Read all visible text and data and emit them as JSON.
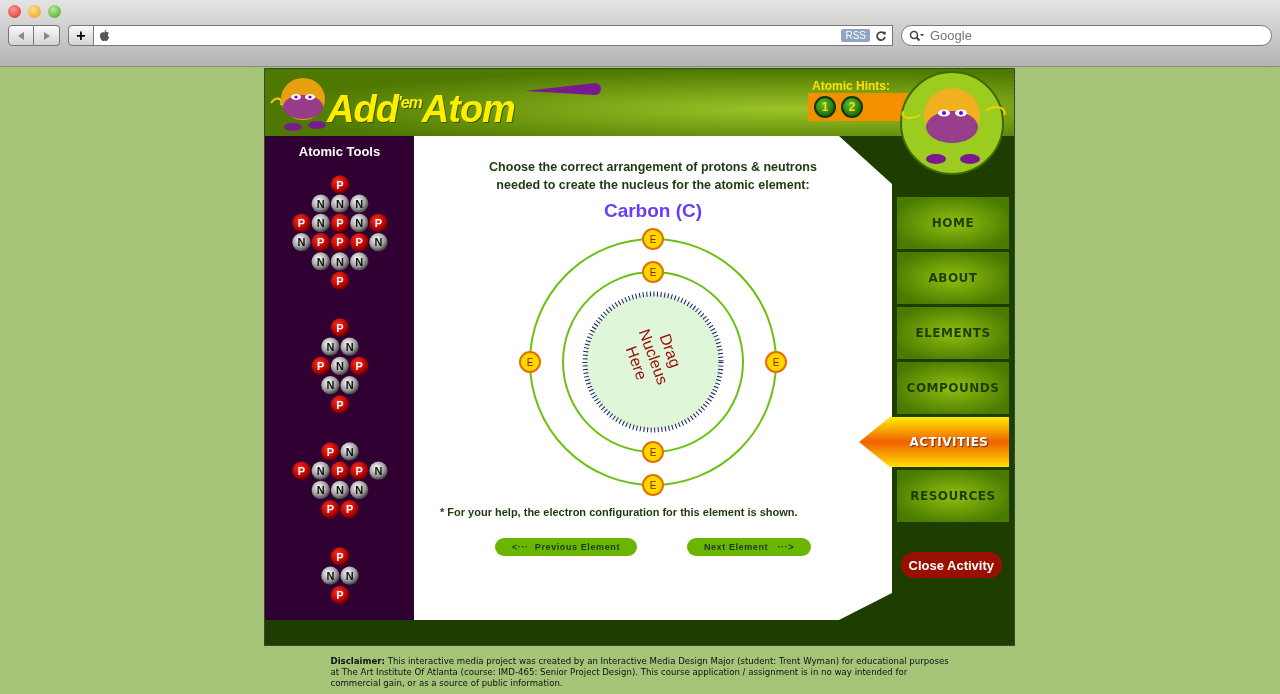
{
  "browser": {
    "rss_badge": "RSS",
    "search": {
      "placeholder": "Google"
    },
    "add_button": "+"
  },
  "header": {
    "logo": "Add$^{'em}$Atom",
    "hints_label": "Atomic Hints:",
    "hints": [
      "1",
      "2"
    ]
  },
  "sidebar": {
    "title": "Atomic Tools",
    "clusters": [
      {
        "particles": [
          {
            "label": "P",
            "kind": "proton"
          },
          {
            "label": "N",
            "kind": "neutron"
          },
          {
            "label": "N",
            "kind": "neutron"
          },
          {
            "label": "N",
            "kind": "neutron"
          },
          {
            "label": "P",
            "kind": "proton"
          },
          {
            "label": "N",
            "kind": "neutron"
          },
          {
            "label": "P",
            "kind": "proton"
          },
          {
            "label": "N",
            "kind": "neutron"
          },
          {
            "label": "P",
            "kind": "proton"
          },
          {
            "label": "N",
            "kind": "neutron"
          },
          {
            "label": "P",
            "kind": "proton"
          },
          {
            "label": "P",
            "kind": "proton"
          },
          {
            "label": "P",
            "kind": "proton"
          },
          {
            "label": "N",
            "kind": "neutron"
          },
          {
            "label": "N",
            "kind": "neutron"
          },
          {
            "label": "N",
            "kind": "neutron"
          },
          {
            "label": "N",
            "kind": "neutron"
          },
          {
            "label": "P",
            "kind": "proton"
          }
        ]
      },
      {
        "particles": [
          {
            "label": "P",
            "kind": "proton"
          },
          {
            "label": "N",
            "kind": "neutron"
          },
          {
            "label": "N",
            "kind": "neutron"
          },
          {
            "label": "P",
            "kind": "proton"
          },
          {
            "label": "N",
            "kind": "neutron"
          },
          {
            "label": "P",
            "kind": "proton"
          },
          {
            "label": "N",
            "kind": "neutron"
          },
          {
            "label": "N",
            "kind": "neutron"
          },
          {
            "label": "P",
            "kind": "proton"
          }
        ]
      },
      {
        "particles": [
          {
            "label": "P",
            "kind": "proton"
          },
          {
            "label": "N",
            "kind": "neutron"
          },
          {
            "label": "P",
            "kind": "proton"
          },
          {
            "label": "N",
            "kind": "neutron"
          },
          {
            "label": "P",
            "kind": "proton"
          },
          {
            "label": "P",
            "kind": "proton"
          },
          {
            "label": "N",
            "kind": "neutron"
          },
          {
            "label": "N",
            "kind": "neutron"
          },
          {
            "label": "N",
            "kind": "neutron"
          },
          {
            "label": "N",
            "kind": "neutron"
          },
          {
            "label": "P",
            "kind": "proton"
          },
          {
            "label": "P",
            "kind": "proton"
          }
        ]
      },
      {
        "particles": [
          {
            "label": "P",
            "kind": "proton"
          },
          {
            "label": "N",
            "kind": "neutron"
          },
          {
            "label": "N",
            "kind": "neutron"
          },
          {
            "label": "P",
            "kind": "proton"
          }
        ]
      }
    ]
  },
  "activity": {
    "instructions": "Choose the correct arrangement of protons & neutrons needed to create the nucleus for the atomic element:",
    "element": "Carbon (C)",
    "drop_zone": "Drag Nucleus Here",
    "shells": [
      {
        "electrons": [
          "E",
          "E"
        ]
      },
      {
        "electrons": [
          "E",
          "E",
          "E",
          "E"
        ]
      }
    ],
    "note": "* For your help, the electron configuration for this element is shown.",
    "previous": "<···  Previous Element",
    "next": "Next Element   ···>"
  },
  "nav": [
    {
      "label": "HOME",
      "selected": false
    },
    {
      "label": "ABOUT",
      "selected": false
    },
    {
      "label": "ELEMENTS",
      "selected": false
    },
    {
      "label": "COMPOUNDS",
      "selected": false
    },
    {
      "label": "ACTIVITIES",
      "selected": true
    },
    {
      "label": "RESOURCES",
      "selected": false
    }
  ],
  "close_button": "Close Activity",
  "disclaimer": "**Disclaimer:**     This interactive media project was created by an Interactive Media Design Major (student: Trent Wyman) for educational purposes at The Art Institute Of Atlanta (course: IMD-465: Senior Project Design).  This course application / assignment is in no way intended for commercial gain, or as a source of public information."
}
